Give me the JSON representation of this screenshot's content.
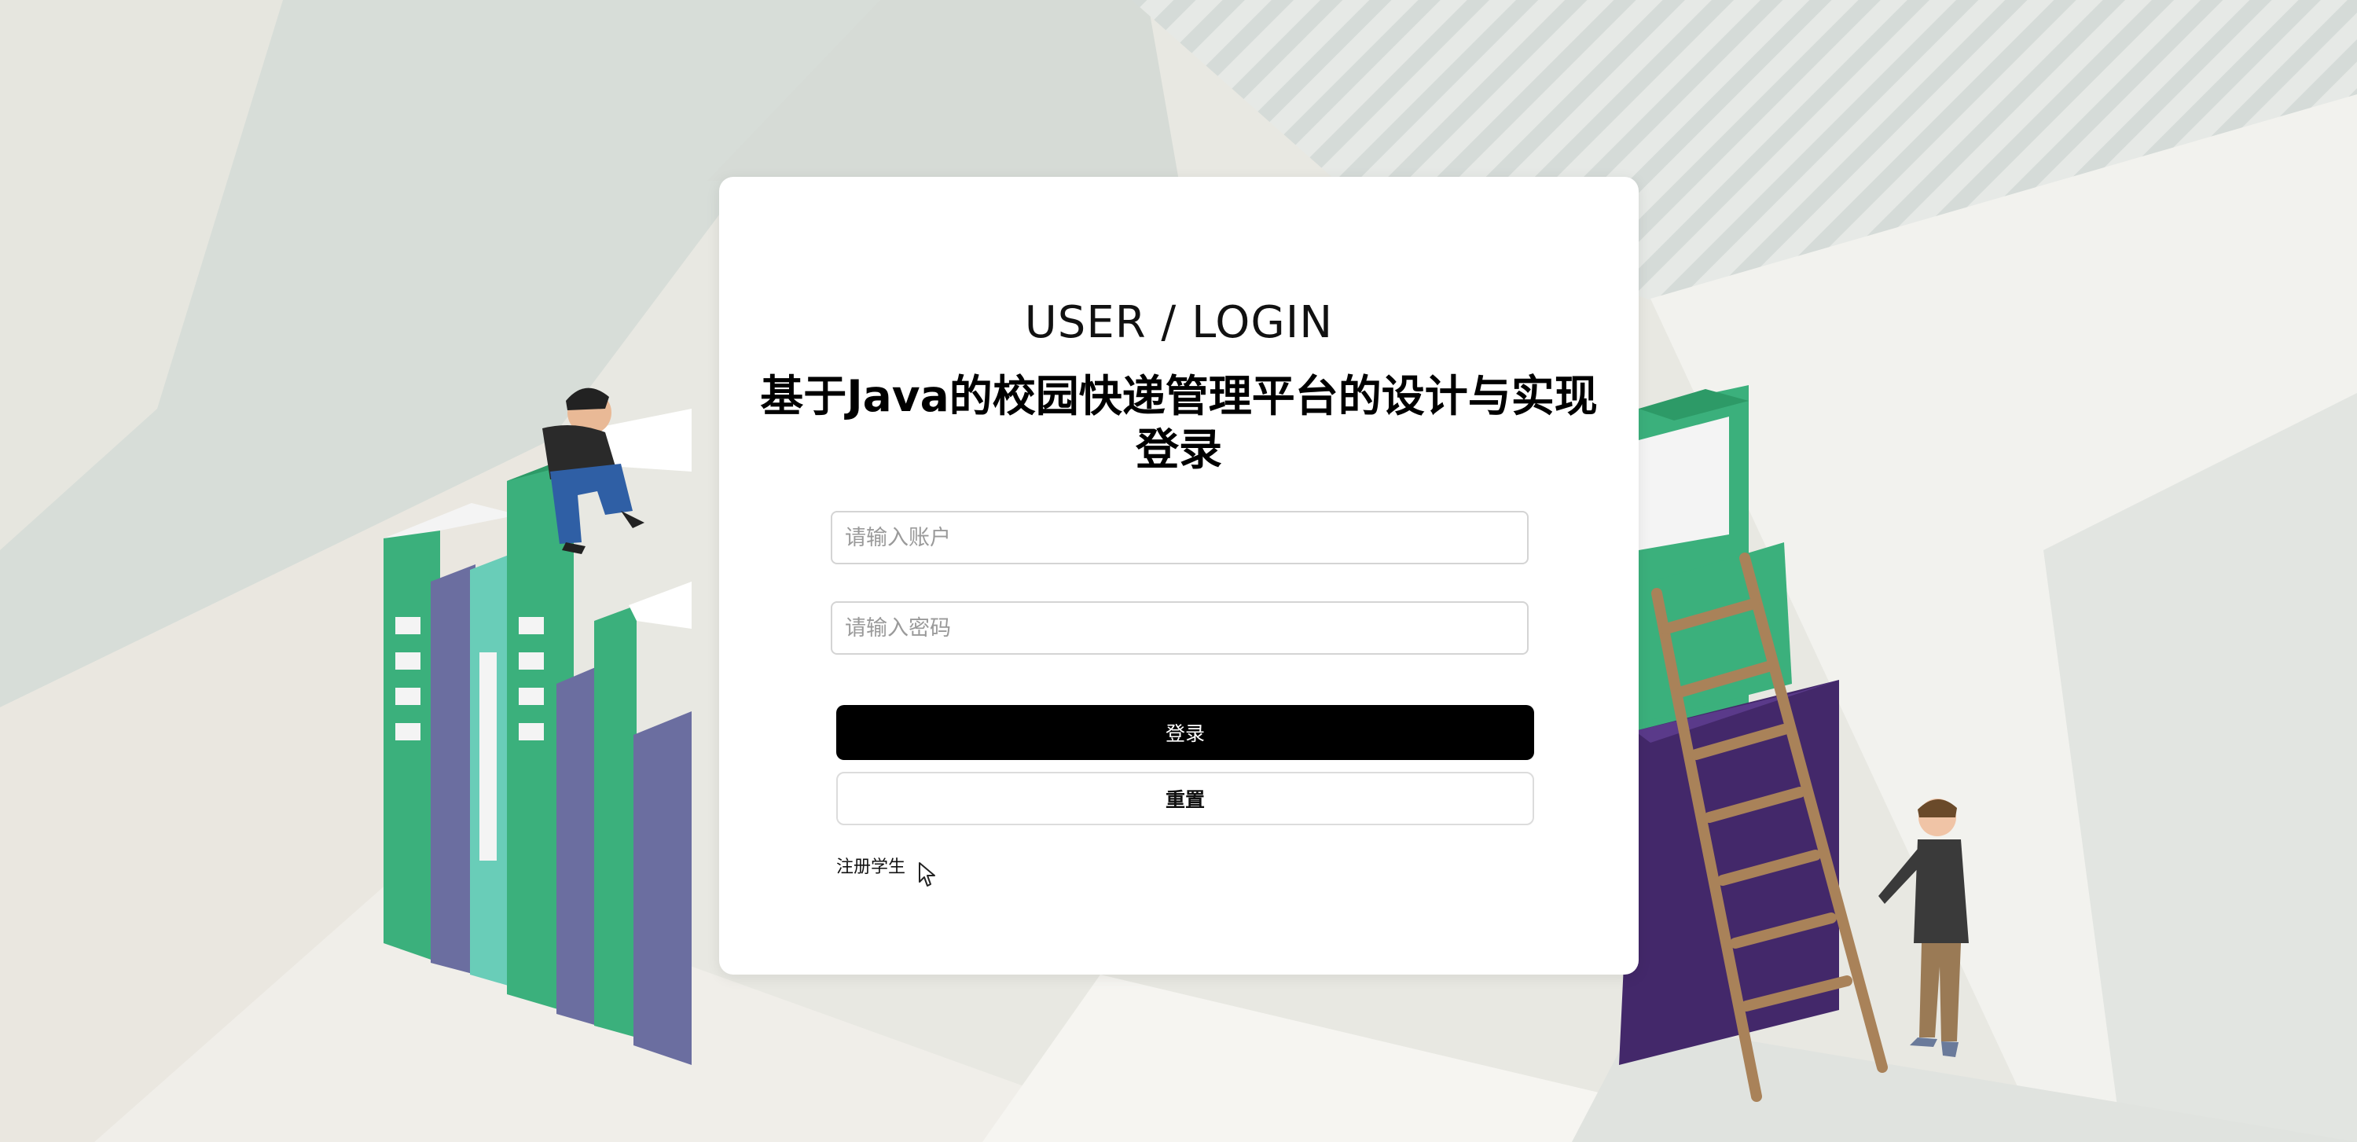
{
  "login": {
    "heading": "USER / LOGIN",
    "title_line1": "基于Java的校园快递管理平台的设计与实现",
    "title_line2": "登录",
    "account_placeholder": "请输入账户",
    "password_placeholder": "请输入密码",
    "login_button": "登录",
    "reset_button": "重置",
    "register_link": "注册学生"
  },
  "colors": {
    "background": "#e9e8e2",
    "card": "#ffffff",
    "primary_button": "#000000",
    "book_green": "#3bb07c",
    "book_purple": "#6b6ea0",
    "book_dark_purple": "#43286a",
    "ladder": "#a98259"
  },
  "icons": {
    "cursor": "mouse-pointer-icon"
  }
}
